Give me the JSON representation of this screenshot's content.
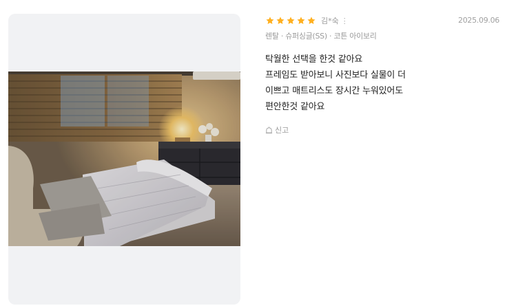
{
  "review": {
    "rating": 5,
    "rating_max": 5,
    "reviewer": "김*숙",
    "date": "2025.09.06",
    "option": "렌탈 · 슈퍼싱글(SS) · 코튼 아이보리",
    "body_lines": [
      "탁월한 선택을 한것 같아요",
      "프레임도 받아보니 사진보다 실물이 더",
      "이쁘고 매트리스도 장시간 누워있어도",
      "편안한것 같아요"
    ],
    "report_label": "신고"
  },
  "icons": {
    "star": "star-icon",
    "more": "more-vertical-icon",
    "report": "report-icon"
  },
  "colors": {
    "star": "#ffb020",
    "muted_text": "#9a9a9a",
    "body_text": "#222222",
    "card_bg": "#f1f2f4"
  }
}
